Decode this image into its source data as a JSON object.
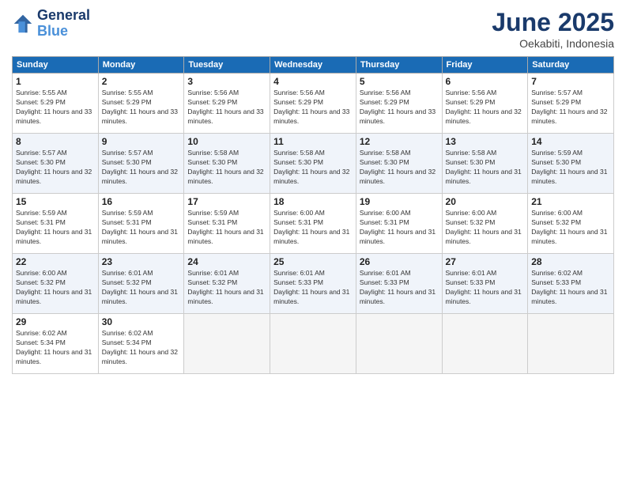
{
  "logo": {
    "line1": "General",
    "line2": "Blue"
  },
  "title": "June 2025",
  "subtitle": "Oekabiti, Indonesia",
  "weekdays": [
    "Sunday",
    "Monday",
    "Tuesday",
    "Wednesday",
    "Thursday",
    "Friday",
    "Saturday"
  ],
  "weeks": [
    [
      {
        "day": "1",
        "sunrise": "5:55 AM",
        "sunset": "5:29 PM",
        "daylight": "11 hours and 33 minutes."
      },
      {
        "day": "2",
        "sunrise": "5:55 AM",
        "sunset": "5:29 PM",
        "daylight": "11 hours and 33 minutes."
      },
      {
        "day": "3",
        "sunrise": "5:56 AM",
        "sunset": "5:29 PM",
        "daylight": "11 hours and 33 minutes."
      },
      {
        "day": "4",
        "sunrise": "5:56 AM",
        "sunset": "5:29 PM",
        "daylight": "11 hours and 33 minutes."
      },
      {
        "day": "5",
        "sunrise": "5:56 AM",
        "sunset": "5:29 PM",
        "daylight": "11 hours and 33 minutes."
      },
      {
        "day": "6",
        "sunrise": "5:56 AM",
        "sunset": "5:29 PM",
        "daylight": "11 hours and 32 minutes."
      },
      {
        "day": "7",
        "sunrise": "5:57 AM",
        "sunset": "5:29 PM",
        "daylight": "11 hours and 32 minutes."
      }
    ],
    [
      {
        "day": "8",
        "sunrise": "5:57 AM",
        "sunset": "5:30 PM",
        "daylight": "11 hours and 32 minutes."
      },
      {
        "day": "9",
        "sunrise": "5:57 AM",
        "sunset": "5:30 PM",
        "daylight": "11 hours and 32 minutes."
      },
      {
        "day": "10",
        "sunrise": "5:58 AM",
        "sunset": "5:30 PM",
        "daylight": "11 hours and 32 minutes."
      },
      {
        "day": "11",
        "sunrise": "5:58 AM",
        "sunset": "5:30 PM",
        "daylight": "11 hours and 32 minutes."
      },
      {
        "day": "12",
        "sunrise": "5:58 AM",
        "sunset": "5:30 PM",
        "daylight": "11 hours and 32 minutes."
      },
      {
        "day": "13",
        "sunrise": "5:58 AM",
        "sunset": "5:30 PM",
        "daylight": "11 hours and 31 minutes."
      },
      {
        "day": "14",
        "sunrise": "5:59 AM",
        "sunset": "5:30 PM",
        "daylight": "11 hours and 31 minutes."
      }
    ],
    [
      {
        "day": "15",
        "sunrise": "5:59 AM",
        "sunset": "5:31 PM",
        "daylight": "11 hours and 31 minutes."
      },
      {
        "day": "16",
        "sunrise": "5:59 AM",
        "sunset": "5:31 PM",
        "daylight": "11 hours and 31 minutes."
      },
      {
        "day": "17",
        "sunrise": "5:59 AM",
        "sunset": "5:31 PM",
        "daylight": "11 hours and 31 minutes."
      },
      {
        "day": "18",
        "sunrise": "6:00 AM",
        "sunset": "5:31 PM",
        "daylight": "11 hours and 31 minutes."
      },
      {
        "day": "19",
        "sunrise": "6:00 AM",
        "sunset": "5:31 PM",
        "daylight": "11 hours and 31 minutes."
      },
      {
        "day": "20",
        "sunrise": "6:00 AM",
        "sunset": "5:32 PM",
        "daylight": "11 hours and 31 minutes."
      },
      {
        "day": "21",
        "sunrise": "6:00 AM",
        "sunset": "5:32 PM",
        "daylight": "11 hours and 31 minutes."
      }
    ],
    [
      {
        "day": "22",
        "sunrise": "6:00 AM",
        "sunset": "5:32 PM",
        "daylight": "11 hours and 31 minutes."
      },
      {
        "day": "23",
        "sunrise": "6:01 AM",
        "sunset": "5:32 PM",
        "daylight": "11 hours and 31 minutes."
      },
      {
        "day": "24",
        "sunrise": "6:01 AM",
        "sunset": "5:32 PM",
        "daylight": "11 hours and 31 minutes."
      },
      {
        "day": "25",
        "sunrise": "6:01 AM",
        "sunset": "5:33 PM",
        "daylight": "11 hours and 31 minutes."
      },
      {
        "day": "26",
        "sunrise": "6:01 AM",
        "sunset": "5:33 PM",
        "daylight": "11 hours and 31 minutes."
      },
      {
        "day": "27",
        "sunrise": "6:01 AM",
        "sunset": "5:33 PM",
        "daylight": "11 hours and 31 minutes."
      },
      {
        "day": "28",
        "sunrise": "6:02 AM",
        "sunset": "5:33 PM",
        "daylight": "11 hours and 31 minutes."
      }
    ],
    [
      {
        "day": "29",
        "sunrise": "6:02 AM",
        "sunset": "5:34 PM",
        "daylight": "11 hours and 31 minutes."
      },
      {
        "day": "30",
        "sunrise": "6:02 AM",
        "sunset": "5:34 PM",
        "daylight": "11 hours and 32 minutes."
      },
      null,
      null,
      null,
      null,
      null
    ]
  ]
}
